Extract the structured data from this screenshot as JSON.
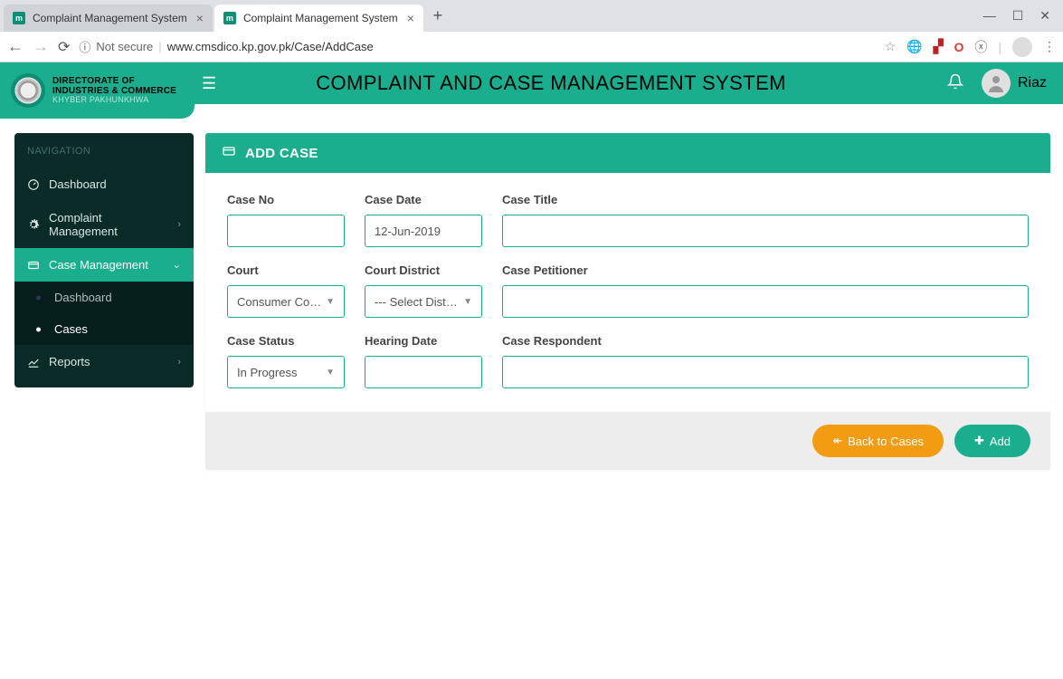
{
  "browser": {
    "tabs": [
      {
        "title": "Complaint Management System"
      },
      {
        "title": "Complaint Management System"
      }
    ],
    "not_secure": "Not secure",
    "url": "www.cmsdico.kp.gov.pk/Case/AddCase"
  },
  "org": {
    "line1": "DIRECTORATE OF",
    "line2": "INDUSTRIES & COMMERCE",
    "sub": "KHYBER PAKHUNKHWA"
  },
  "app": {
    "title": "COMPLAINT AND CASE MANAGEMENT SYSTEM",
    "user": "Riaz"
  },
  "sidebar": {
    "header": "NAVIGATION",
    "items": [
      {
        "label": "Dashboard"
      },
      {
        "label": "Complaint Management"
      },
      {
        "label": "Case Management",
        "sub": [
          {
            "label": "Dashboard"
          },
          {
            "label": "Cases"
          }
        ]
      },
      {
        "label": "Reports"
      }
    ]
  },
  "panel": {
    "title": "ADD CASE"
  },
  "form": {
    "case_no": {
      "label": "Case No",
      "value": ""
    },
    "case_date": {
      "label": "Case Date",
      "value": "12-Jun-2019"
    },
    "case_title": {
      "label": "Case Title",
      "value": ""
    },
    "court": {
      "label": "Court",
      "value": "Consumer Court"
    },
    "court_district": {
      "label": "Court District",
      "value": "--- Select Distri..."
    },
    "case_petitioner": {
      "label": "Case Petitioner",
      "value": ""
    },
    "case_status": {
      "label": "Case Status",
      "value": "In Progress"
    },
    "hearing_date": {
      "label": "Hearing Date",
      "value": ""
    },
    "case_respondent": {
      "label": "Case Respondent",
      "value": ""
    }
  },
  "footer": {
    "back": "Back to Cases",
    "add": "Add"
  }
}
